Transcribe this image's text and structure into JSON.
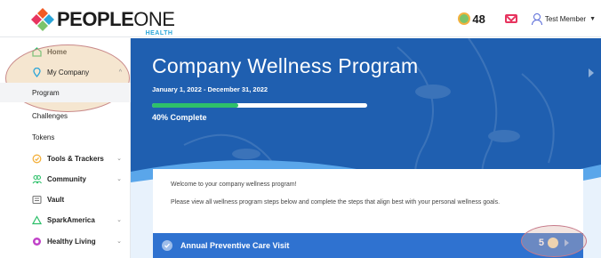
{
  "brand": {
    "name_bold": "PEOPLE",
    "name_light": "ONE",
    "tagline": "HEALTH"
  },
  "header": {
    "points": "48",
    "user_name": "Test Member"
  },
  "sidebar": {
    "items": [
      {
        "label": "Home",
        "icon": "home-icon"
      },
      {
        "label": "My Company",
        "icon": "location-pin-icon"
      },
      {
        "label": "Program"
      },
      {
        "label": "Challenges"
      },
      {
        "label": "Tokens"
      },
      {
        "label": "Tools & Trackers",
        "icon": "tools-icon"
      },
      {
        "label": "Community",
        "icon": "community-icon"
      },
      {
        "label": "Vault",
        "icon": "vault-icon"
      },
      {
        "label": "SparkAmerica",
        "icon": "triangle-icon"
      },
      {
        "label": "Healthy Living",
        "icon": "healthy-living-icon"
      }
    ]
  },
  "hero": {
    "title": "Company Wellness Program",
    "dates": "January 1, 2022 - December 31, 2022",
    "progress_percent": 40,
    "progress_label": "40% Complete"
  },
  "card": {
    "welcome": "Welcome to your company wellness program!",
    "instructions": "Please view all wellness program steps below and complete the steps that align best with your personal wellness goals."
  },
  "step": {
    "title": "Annual Preventive Care Visit",
    "points": "5"
  },
  "colors": {
    "hero_blue": "#1f5fb0",
    "step_blue": "#2f72d0",
    "progress_green": "#2ec06a",
    "accent_pink": "#e7345f",
    "accent_orange": "#f3b13e"
  }
}
